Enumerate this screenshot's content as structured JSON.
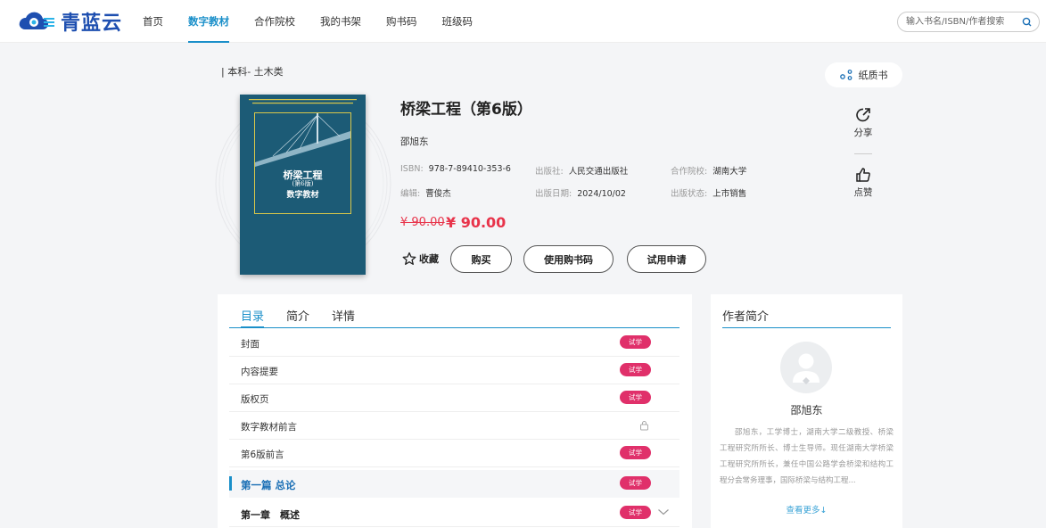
{
  "header": {
    "logo_text": "青蓝云",
    "nav": [
      {
        "label": "首页",
        "active": false
      },
      {
        "label": "数字教材",
        "active": true
      },
      {
        "label": "合作院校",
        "active": false
      },
      {
        "label": "我的书架",
        "active": false
      },
      {
        "label": "购书码",
        "active": false
      },
      {
        "label": "班级码",
        "active": false
      }
    ],
    "search_placeholder": "输入书名/ISBN/作者搜索"
  },
  "breadcrumb": "| 本科- 土木类",
  "paper_book_label": "纸质书",
  "book": {
    "title": "桥梁工程（第6版）",
    "author": "邵旭东",
    "isbn_label": "ISBN:",
    "isbn": "978-7-89410-353-6",
    "publisher_label": "出版社:",
    "publisher": "人民交通出版社",
    "school_label": "合作院校:",
    "school": "湖南大学",
    "editor_label": "编辑:",
    "editor": "曹俊杰",
    "date_label": "出版日期:",
    "date": "2024/10/02",
    "status_label": "出版状态:",
    "status": "上市销售",
    "old_price": "¥ 90.00",
    "price": "¥ 90.00",
    "cover": {
      "title": "桥梁工程",
      "edition": "(第6版)",
      "subtitle": "数字教材"
    }
  },
  "actions": {
    "favorite": "收藏",
    "buy": "购买",
    "use_code": "使用购书码",
    "trial": "试用申请",
    "share": "分享",
    "like": "点赞"
  },
  "toc": {
    "tabs": [
      {
        "label": "目录",
        "active": true
      },
      {
        "label": "简介",
        "active": false
      },
      {
        "label": "详情",
        "active": false
      }
    ],
    "trial_badge": "试学",
    "rows": [
      {
        "label": "封面",
        "trial": true,
        "locked": false
      },
      {
        "label": "内容提要",
        "trial": true,
        "locked": false
      },
      {
        "label": "版权页",
        "trial": true,
        "locked": false
      },
      {
        "label": "数字教材前言",
        "trial": false,
        "locked": true
      },
      {
        "label": "第6版前言",
        "trial": true,
        "locked": false
      },
      {
        "label": "第一篇 总论",
        "trial": true,
        "locked": false,
        "section": true
      },
      {
        "label": "第一章　概述",
        "trial": true,
        "locked": false,
        "chapter": true,
        "expandable": true
      }
    ]
  },
  "author_panel": {
    "heading": "作者简介",
    "name": "邵旭东",
    "bio": "邵旭东，工学博士，湖南大学二级教授、桥梁工程研究所所长、博士生导师。现任湖南大学桥梁工程研究所所长，兼任中国公路学会桥梁和结构工程分会常务理事，国际桥梁与结构工程...",
    "more": "查看更多↓"
  },
  "colors": {
    "accent": "#1a8fc9",
    "price": "#e8334a",
    "badge": "#e0306a",
    "cover": "#1c5b76",
    "logo": "#1e4fb0"
  }
}
